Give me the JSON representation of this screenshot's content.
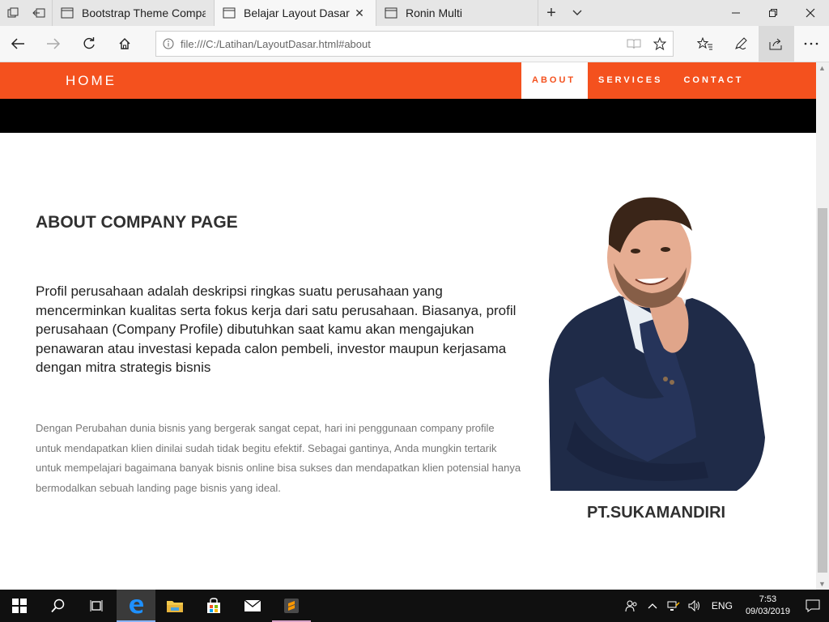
{
  "browser": {
    "tabs": [
      {
        "title": "Bootstrap Theme Company",
        "active": false
      },
      {
        "title": "Belajar Layout Dasar",
        "active": true
      },
      {
        "title": "Ronin Multi",
        "active": false
      }
    ],
    "url": "file:///C:/Latihan/LayoutDasar.html#about"
  },
  "site": {
    "brand": "HOME",
    "menu": [
      {
        "label": "ABOUT",
        "active": true
      },
      {
        "label": "SERVICES",
        "active": false
      },
      {
        "label": "CONTACT",
        "active": false
      }
    ],
    "accent_color": "#f4511e"
  },
  "about": {
    "title": "ABOUT COMPANY PAGE",
    "lead": "Profil perusahaan adalah deskripsi ringkas suatu perusahaan yang mencerminkan kualitas serta fokus kerja dari satu perusahaan. Biasanya, profil perusahaan (Company Profile) dibutuhkan saat kamu akan mengajukan penawaran atau investasi kepada calon pembeli, investor maupun kerjasama dengan mitra strategis bisnis",
    "body": "Dengan Perubahan dunia bisnis yang bergerak sangat cepat, hari ini penggunaan company profile untuk mendapatkan klien dinilai sudah tidak begitu efektif. Sebagai gantinya, Anda mungkin tertarik untuk mempelajari bagaimana banyak bisnis online bisa sukses dan mendapatkan klien potensial hanya bermodalkan sebuah landing page bisnis yang ideal.",
    "company": "PT.SUKAMANDIRI"
  },
  "taskbar": {
    "language": "ENG",
    "time": "7:53",
    "date": "09/03/2019"
  }
}
